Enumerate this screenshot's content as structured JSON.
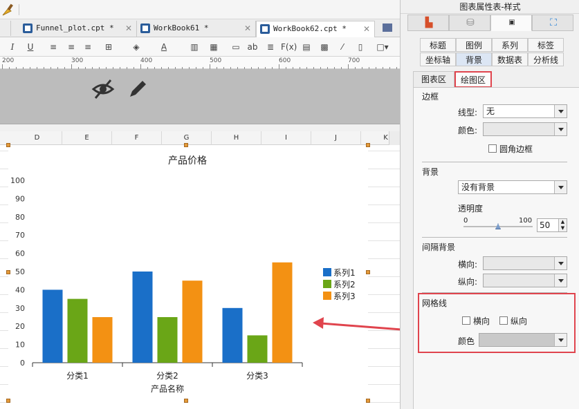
{
  "tabs": [
    {
      "label": "Funnel_plot.cpt *"
    },
    {
      "label": "WorkBook61 *"
    },
    {
      "label": "WorkBook62.cpt *"
    }
  ],
  "format_bar": {
    "underline": "U",
    "italic": "I",
    "ab": "ab",
    "fx": "F(x)"
  },
  "ruler": {
    "marks": [
      "200",
      "300",
      "400",
      "500",
      "600",
      "700"
    ]
  },
  "columns": [
    "D",
    "E",
    "F",
    "G",
    "H",
    "I",
    "J",
    "K"
  ],
  "chart_data": {
    "type": "bar",
    "title": "产品价格",
    "xlabel": "产品名称",
    "ylabel": "",
    "categories": [
      "分类1",
      "分类2",
      "分类3"
    ],
    "series": [
      {
        "name": "系列1",
        "values": [
          40,
          50,
          30
        ],
        "color": "#1a6fc8"
      },
      {
        "name": "系列2",
        "values": [
          35,
          25,
          15
        ],
        "color": "#6aa617"
      },
      {
        "name": "系列3",
        "values": [
          25,
          45,
          55
        ],
        "color": "#f39113"
      }
    ],
    "ylim": [
      0,
      100
    ],
    "yticks": [
      "0",
      "10",
      "20",
      "30",
      "40",
      "50",
      "60",
      "70",
      "80",
      "90",
      "100"
    ],
    "legend_position": "right"
  },
  "panel": {
    "title": "图表属性表-样式",
    "subtabs": [
      "标题",
      "图例",
      "系列",
      "标签",
      "坐标轴",
      "背景",
      "数据表",
      "分析线"
    ],
    "area_tabs": [
      "图表区",
      "绘图区"
    ],
    "border": {
      "section": "边框",
      "line_label": "线型:",
      "line_value": "无",
      "color_label": "颜色:",
      "rounded_label": "圆角边框"
    },
    "background": {
      "section": "背景",
      "value": "没有背景",
      "opacity_label": "透明度",
      "slider_min": "0",
      "slider_max": "100",
      "opacity_value": "50"
    },
    "interval": {
      "section": "间隔背景",
      "horizontal_label": "横向:",
      "vertical_label": "纵向:"
    },
    "gridlines": {
      "section": "网格线",
      "horizontal_label": "横向",
      "vertical_label": "纵向",
      "color_label": "颜色"
    }
  }
}
